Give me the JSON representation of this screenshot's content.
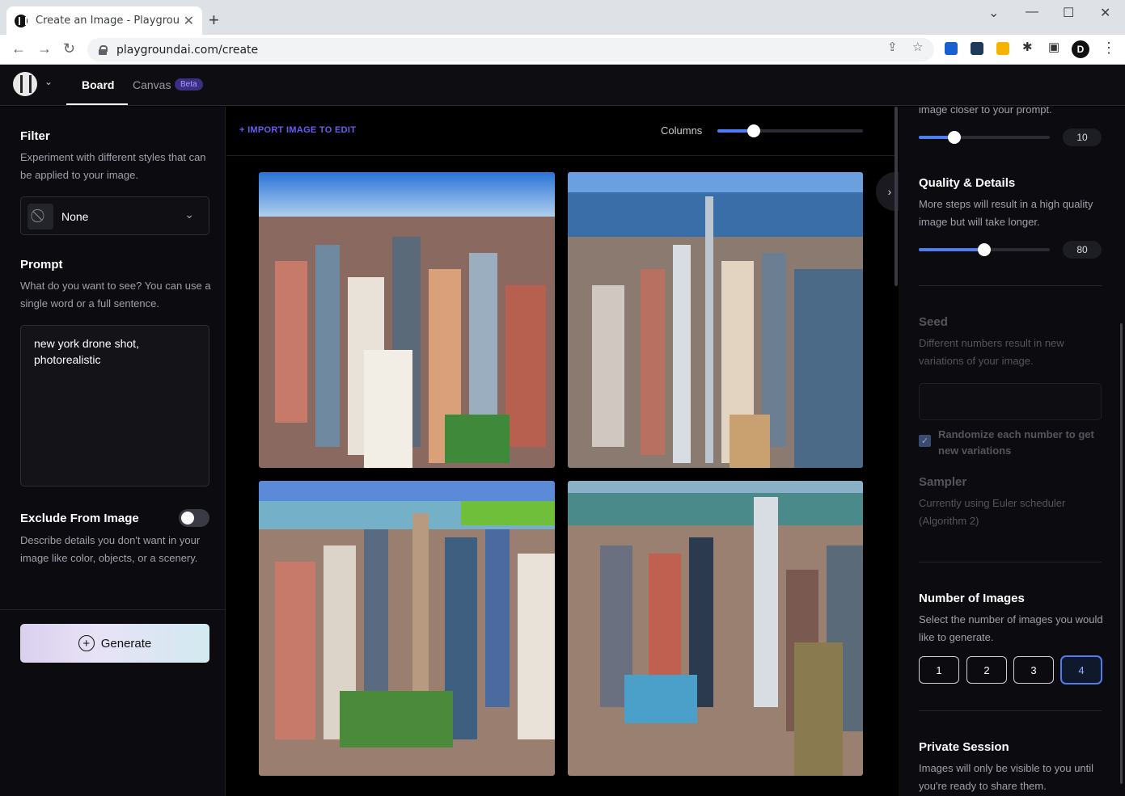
{
  "browser": {
    "tab_title": "Create an Image - Playground AI",
    "new_tab": "+",
    "url": "playgroundai.com/create",
    "profile_initial": "D",
    "window_controls": [
      "minimize-icon",
      "maximize-icon",
      "close-icon"
    ]
  },
  "app": {
    "tabs": [
      {
        "label": "Board",
        "active": true
      },
      {
        "label": "Canvas",
        "active": false,
        "badge": "Beta"
      }
    ]
  },
  "left": {
    "filter": {
      "title": "Filter",
      "desc": "Experiment with different styles that can be applied to your image.",
      "value": "None"
    },
    "prompt": {
      "title": "Prompt",
      "desc": "What do you want to see? You can use a single word or a full sentence.",
      "value": "new york drone shot, photorealistic"
    },
    "exclude": {
      "title": "Exclude From Image",
      "desc": "Describe details you don't want in your image like color, objects, or a scenery.",
      "enabled": false
    },
    "generate_label": "Generate"
  },
  "center": {
    "import_label": "+ IMPORT IMAGE TO EDIT",
    "columns_label": "Columns",
    "columns_slider_fraction": 0.25,
    "images": [
      {
        "name": "generated-image-1"
      },
      {
        "name": "generated-image-2"
      },
      {
        "name": "generated-image-3"
      },
      {
        "name": "generated-image-4"
      }
    ]
  },
  "right": {
    "guidance": {
      "desc_tail": "image closer to your prompt.",
      "value": "10",
      "slider_fraction": 0.27
    },
    "quality": {
      "title": "Quality & Details",
      "desc": "More steps will result in a high quality image but will take longer.",
      "value": "80",
      "slider_fraction": 0.5
    },
    "seed": {
      "title": "Seed",
      "desc": "Different numbers result in new variations of your image.",
      "value": "",
      "randomize_label": "Randomize each number to get new variations",
      "randomize_checked": true
    },
    "sampler": {
      "title": "Sampler",
      "desc": "Currently using Euler scheduler (Algorithm 2)"
    },
    "num_images": {
      "title": "Number of Images",
      "desc": "Select the number of images you would like to generate.",
      "options": [
        "1",
        "2",
        "3",
        "4"
      ],
      "selected": "4"
    },
    "private": {
      "title": "Private Session",
      "desc": "Images will only be visible to you until you're ready to share them."
    }
  },
  "colors": {
    "accent": "#4f7df0",
    "link": "#6b5cf0",
    "panel": "#0b0b10"
  }
}
